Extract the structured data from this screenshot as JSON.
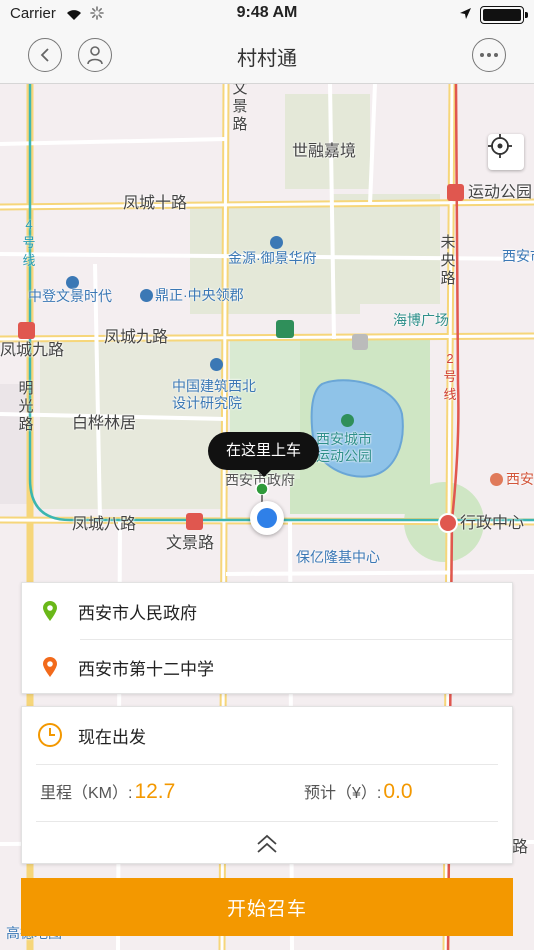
{
  "status_bar": {
    "carrier": "Carrier",
    "time": "9:48 AM"
  },
  "nav": {
    "title": "村村通"
  },
  "map": {
    "labels": {
      "wenjing_top": "文景路",
      "shirong": "世融嘉境",
      "fengcheng10": "凤城十路",
      "yundong_park_station": "运动公园",
      "jinyuan": "金源·御景华府",
      "weiyang": "未央路",
      "line4": "4号线",
      "zhongdeng": "中登文景时代",
      "dingzheng": "鼎正·中央领郡",
      "xian_5": "西安市第五",
      "haibo": "海博广场",
      "fengcheng9_west": "凤城九路",
      "fengcheng9": "凤城九路",
      "zhongjian": "中国建筑西北设计研究院",
      "line2": "2号线",
      "mingguang": "明光路",
      "baihualin": "白桦林居",
      "sports_park": "西安城市运动公园",
      "gov": "西安市政府",
      "xian_right": "西安",
      "fengcheng8": "凤城八路",
      "wenjing_bottom": "文景路",
      "xingzheng": "行政中心",
      "baoyi": "保亿隆基中心",
      "road_right": "路",
      "gaode": "高德地图"
    }
  },
  "bubble": {
    "text": "在这里上车"
  },
  "pickup": {
    "text": "西安市人民政府"
  },
  "dropoff": {
    "text": "西安市第十二中学"
  },
  "departure": {
    "text": "现在出发"
  },
  "mileage": {
    "label": "里程（KM）:",
    "value": "12.7"
  },
  "fare": {
    "label": "预计（¥）:",
    "value": "0.0"
  },
  "start_button": {
    "label": "开始召车"
  },
  "colors": {
    "accent": "#f39800",
    "pickup_pin": "#6ab819",
    "dropoff_pin": "#f26a1b",
    "location_blue": "#2f80e8"
  }
}
